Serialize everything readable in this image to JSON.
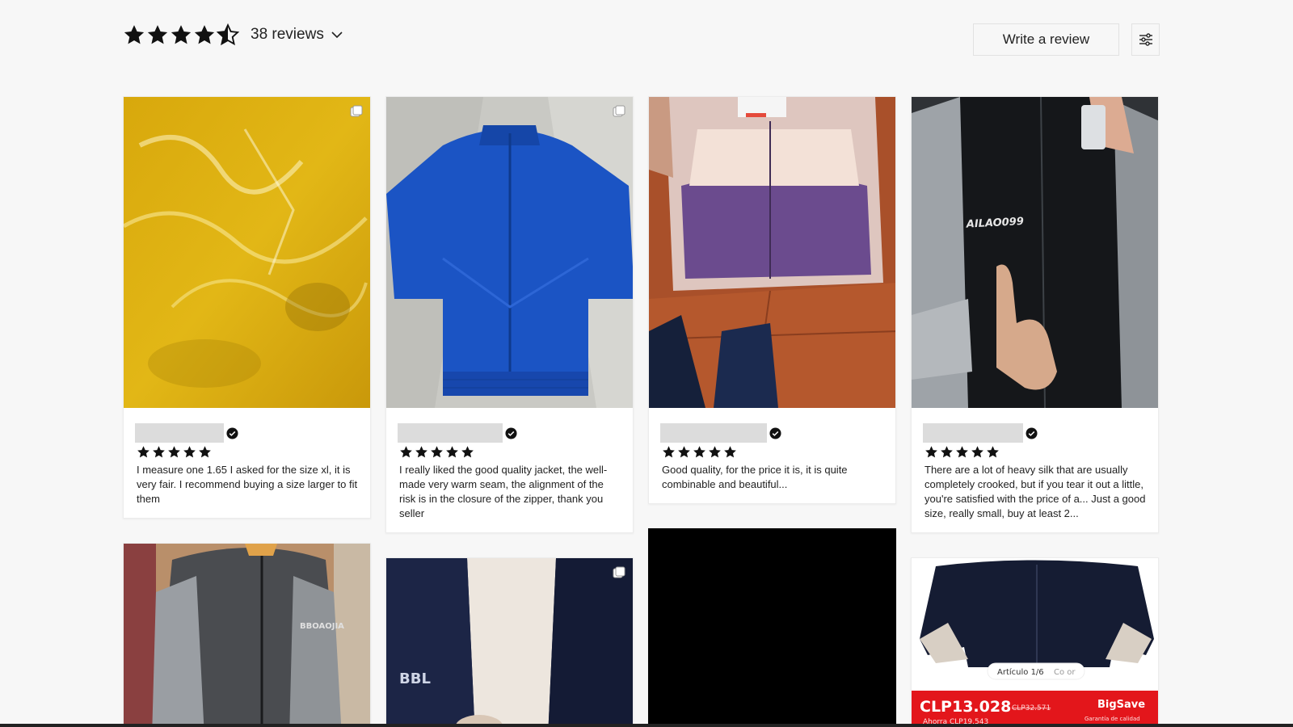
{
  "summary": {
    "rating": 4.5,
    "reviews_label": "38 reviews",
    "write_review_label": "Write a review",
    "filter_icon": "sliders-icon",
    "chevron_icon": "chevron-down-icon"
  },
  "colors": {
    "star": "#111111",
    "name_placeholder": "#dcdcdc",
    "badge_red": "#e3161b"
  },
  "reviews": [
    {
      "rating": 5,
      "text": "I measure one 1.65 I asked for the size xl, it is very fair. I recommend buying a size larger to fit them"
    },
    {
      "rating": 5,
      "text": "I really liked the good quality jacket, the well-made very warm seam, the alignment of the risk is in the closure of the zipper, thank you seller"
    },
    {
      "rating": 5,
      "text": "Good quality, for the price it is, it is quite combinable and beautiful..."
    },
    {
      "rating": 5,
      "text": "There are a lot of heavy silk that are usually completely crooked, but if you tear it out a little, you're satisfied with the price of a... Just a good size, really small, buy at least 2..."
    }
  ],
  "photo_text": {
    "logo_4": "AILAO099",
    "logo_5": "BBOAOJIA",
    "logo_6": "BBL",
    "article_label": "Artículo 1/6",
    "color_label": "Co or",
    "price": "CLP13.028",
    "old_price": "CLP32.571",
    "badge": "BigSave",
    "guarantee": "Garantía de calidad",
    "ahorra": "Ahorra CLP19.543"
  }
}
